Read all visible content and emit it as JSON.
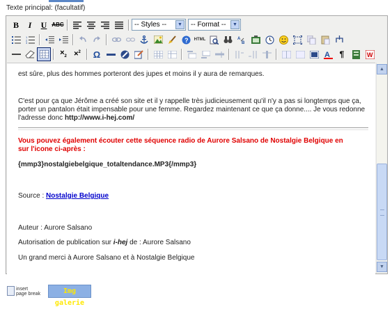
{
  "field_label": "Texte principal: (facultatif)",
  "toolbar": {
    "styles": "-- Styles --",
    "format": "-- Format --"
  },
  "content": {
    "line1": "est sûre, plus des hommes porteront des jupes et moins il y aura de remarques.",
    "para2_line1": "C'est pour ça que Jérôme a créé son site et il y rappelle très judicieusement qu'il n'y a pas si longtemps que ça,",
    "para2_line2": "porter un pantalon était impensable pour une femme. Regardez maintenant ce que ça donne.... Je vous redonne",
    "para2_prefix": "l'adresse donc ",
    "para2_link": "http://www.i-hej.com/",
    "red_line1": "Vous pouvez également écouter cette séquence radio de Aurore Salsano de Nostalgie Belgique en",
    "red_line2": "sur l'icone ci-après :",
    "mp3": "{mmp3}nostalgiebelgique_totaltendance.MP3{/mmp3}",
    "source_label": "Source : ",
    "source_link": "Nostalgie Belgique",
    "author": "Auteur : Aurore Salsano",
    "auth_prefix": "Autorisation de publication sur ",
    "auth_site": "i-hej",
    "auth_suffix": " de : Aurore Salsano",
    "thanks": "Un grand merci à Aurore Salsano et à Nostalgie Belgique"
  },
  "bottom": {
    "pagebreak_1": "insert",
    "pagebreak_2": "page break",
    "img_galerie": "Img galerie"
  }
}
